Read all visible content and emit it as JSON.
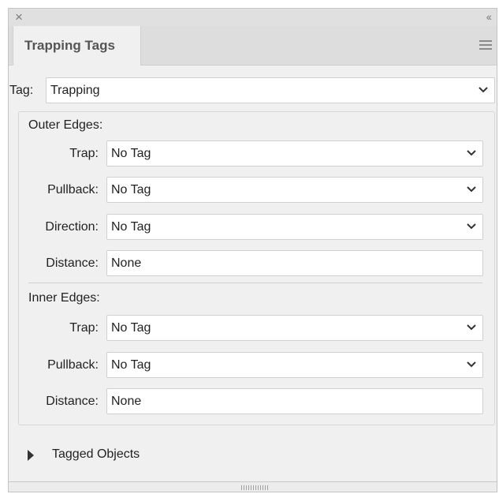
{
  "titlebar": {
    "close_icon": "close-icon",
    "collapse_glyph": "‹‹"
  },
  "tab": {
    "label": "Trapping Tags"
  },
  "menu_icon": "hamburger-menu-icon",
  "tag": {
    "label": "Tag:",
    "value": "Trapping"
  },
  "outer_edges": {
    "heading": "Outer Edges:",
    "trap": {
      "label": "Trap:",
      "value": "No Tag"
    },
    "pullback": {
      "label": "Pullback:",
      "value": "No Tag"
    },
    "direction": {
      "label": "Direction:",
      "value": "No Tag"
    },
    "distance": {
      "label": "Distance:",
      "value": "None"
    }
  },
  "inner_edges": {
    "heading": "Inner Edges:",
    "trap": {
      "label": "Trap:",
      "value": "No Tag"
    },
    "pullback": {
      "label": "Pullback:",
      "value": "No Tag"
    },
    "distance": {
      "label": "Distance:",
      "value": "None"
    }
  },
  "tagged_objects": {
    "label": "Tagged Objects"
  },
  "colors": {
    "panel_bg": "#f0f0f0",
    "field_bg": "#ffffff",
    "border": "#d0d0d0"
  }
}
